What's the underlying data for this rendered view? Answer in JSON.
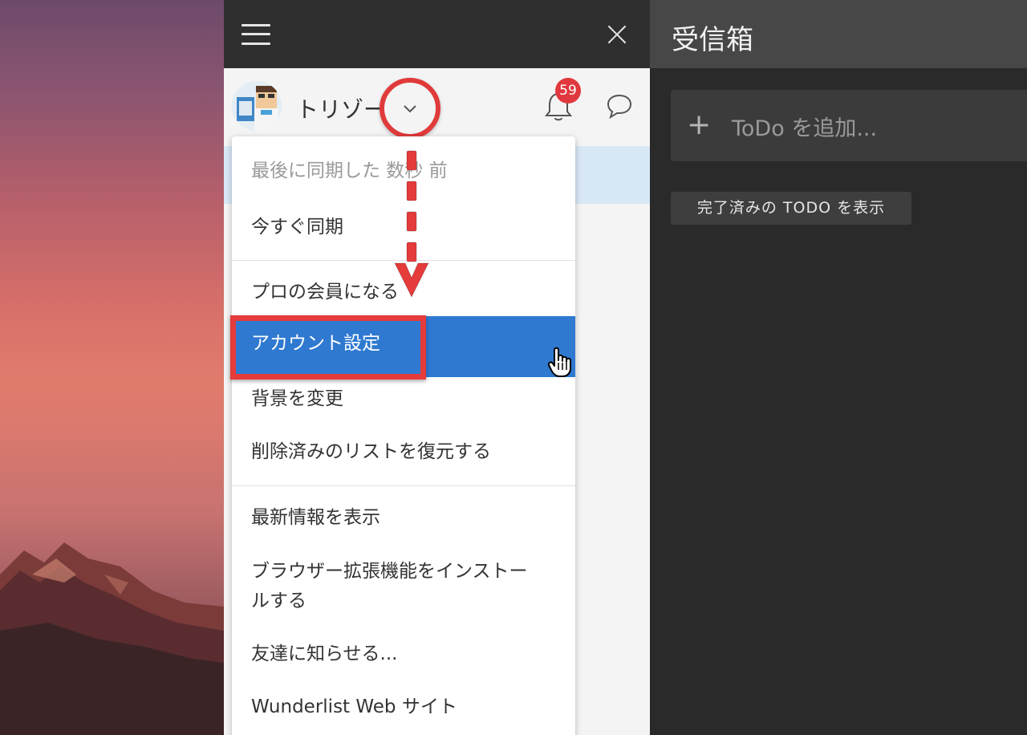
{
  "sidebar": {
    "username": "トリゾー",
    "notification_count": "59"
  },
  "dropdown": {
    "last_synced": "最後に同期した 数秒 前",
    "items": [
      "今すぐ同期",
      "プロの会員になる",
      "アカウント設定",
      "背景を変更",
      "削除済みのリストを復元する",
      "最新情報を表示",
      "ブラウザー拡張機能をインストールする",
      "友達に知らせる...",
      "Wunderlist Web サイト"
    ],
    "install_line1": "ブラウザー拡張機能をインストー",
    "install_line2": "ルする"
  },
  "main": {
    "title": "受信箱",
    "add_todo_placeholder": "ToDo を追加...",
    "show_completed": "完了済みの TODO を表示"
  },
  "colors": {
    "accent_blue": "#2f79d0",
    "annotation_red": "#e53b3b",
    "badge_red": "#e0383e"
  },
  "icons": [
    "menu-icon",
    "close-icon",
    "chevron-down-icon",
    "bell-icon",
    "chat-icon",
    "plus-icon",
    "hand-cursor-icon"
  ]
}
